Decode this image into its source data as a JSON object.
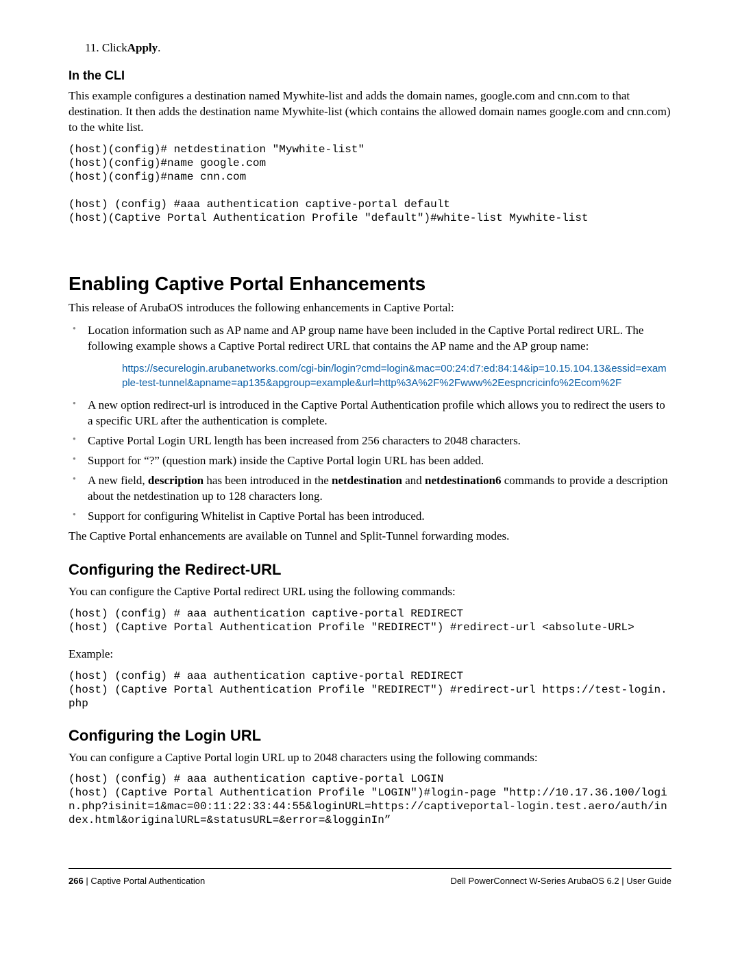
{
  "step11": {
    "num": "11.",
    "prefix": "Click",
    "bold": "Apply",
    "suffix": "."
  },
  "cli": {
    "heading": "In the CLI",
    "intro": "This example configures a destination named Mywhite-list and adds the domain names, google.com and cnn.com to that destination. It then adds the destination name Mywhite-list (which contains the allowed domain names google.com and cnn.com) to the white list.",
    "code": "(host)(config)# netdestination \"Mywhite-list\"\n(host)(config)#name google.com\n(host)(config)#name cnn.com\n\n(host) (config) #aaa authentication captive-portal default\n(host)(Captive Portal Authentication Profile \"default\")#white-list Mywhite-list"
  },
  "enhancements": {
    "heading": "Enabling Captive Portal Enhancements",
    "intro": "This release of ArubaOS introduces the following enhancements in Captive Portal:",
    "bullet1": "Location information such as AP name and AP group name have been included in the Captive Portal redirect URL. The following example shows a Captive Portal redirect URL that contains the AP name and the AP group name:",
    "url": "https://securelogin.arubanetworks.com/cgi-bin/login?cmd=login&mac=00:24:d7:ed:84:14&ip=10.15.104.13&essid=example-test-tunnel&apname=ap135&apgroup=example&url=http%3A%2F%2Fwww%2Eespncricinfo%2Ecom%2F",
    "bullet2": "A new option redirect-url is introduced in the Captive Portal Authentication profile which allows you to redirect the users to a specific URL after the authentication is complete.",
    "bullet3": "Captive Portal Login URL length has been increased from 256 characters to 2048 characters.",
    "bullet4": "Support for “?” (question mark) inside the Captive Portal login URL has been added.",
    "bullet5_pre": "A new field, ",
    "bullet5_b1": "description",
    "bullet5_mid": " has been introduced in the ",
    "bullet5_b2": "netdestination",
    "bullet5_and": " and ",
    "bullet5_b3": "netdestination6",
    "bullet5_post": " commands to provide a description about the netdestination up to 128 characters long.",
    "bullet6": "Support for configuring Whitelist in Captive Portal has been introduced.",
    "outro": "The Captive Portal enhancements are available on Tunnel and Split-Tunnel forwarding modes."
  },
  "redirect": {
    "heading": "Configuring the Redirect-URL",
    "intro": "You can configure the Captive Portal redirect URL using the following commands:",
    "code1": "(host) (config) # aaa authentication captive-portal REDIRECT\n(host) (Captive Portal Authentication Profile \"REDIRECT\") #redirect-url <absolute-URL>",
    "example_label": "Example:",
    "code2": "(host) (config) # aaa authentication captive-portal REDIRECT\n(host) (Captive Portal Authentication Profile \"REDIRECT\") #redirect-url https://test-login.php"
  },
  "login": {
    "heading": "Configuring the Login URL",
    "intro": "You can configure a Captive Portal login URL up to 2048 characters using the following commands:",
    "code": "(host) (config) # aaa authentication captive-portal LOGIN\n(host) (Captive Portal Authentication Profile \"LOGIN\")#login-page \"http://10.17.36.100/login.php?isinit=1&mac=00:11:22:33:44:55&loginURL=https://captiveportal-login.test.aero/auth/index.html&originalURL=&statusURL=&error=&logginIn”"
  },
  "footer": {
    "page": "266",
    "sep": " | ",
    "section": "Captive Portal Authentication",
    "product": "Dell PowerConnect W-Series ArubaOS 6.2",
    "guide": "User Guide"
  }
}
